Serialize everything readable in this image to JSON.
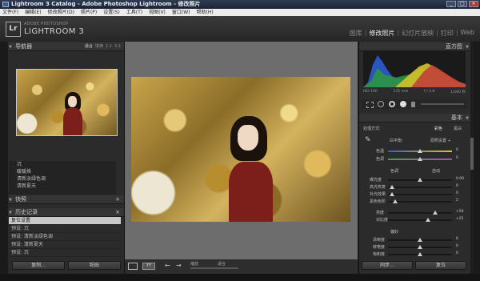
{
  "window": {
    "title": "Lightroom 3 Catalog - Adobe Photoshop Lightroom - 修改照片",
    "controls": [
      "_",
      "□",
      "×"
    ]
  },
  "menu": [
    "文件(F)",
    "编辑(E)",
    "修改照片(D)",
    "照片(P)",
    "设置(S)",
    "工具(T)",
    "视图(V)",
    "窗口(W)",
    "帮助(H)"
  ],
  "header": {
    "logo": "Lr",
    "brand_top": "ADOBE PHOTOSHOP",
    "brand": "LIGHTROOM 3",
    "modules": [
      "图库",
      "修改照片",
      "幻灯片放映",
      "打印",
      "Web"
    ],
    "separator": "|"
  },
  "left": {
    "navigator": {
      "title": "导航器",
      "options": [
        "适合",
        "填满",
        "1:1",
        "3:1"
      ]
    },
    "presets": [
      "沉",
      "暖暖焕",
      "清新淡绿色调",
      "清新夏天"
    ],
    "snapshots": {
      "title": "快照",
      "add": "+"
    },
    "history": {
      "title": "历史记录",
      "close": "×",
      "items": [
        "复位设置",
        "预设: 沉",
        "预设: 清新淡绿色调",
        "预设: 清新夏天",
        "预设: 沉"
      ]
    },
    "buttons": {
      "copy": "复制...",
      "paste": "粘贴"
    }
  },
  "toolbar": {
    "soft_proof": "校样",
    "zoom": "缩放",
    "zoom_value": "适合"
  },
  "right": {
    "histogram": {
      "title": "直方图",
      "iso": "ISO 100",
      "focal": "135 mm",
      "aperture": "f / 2.8",
      "shutter": "1/160 秒"
    },
    "basic": {
      "title": "基本",
      "treatment_label": "处理方式:",
      "color": "彩色",
      "bw": "黑白",
      "wb_label": "白平衡:",
      "wb_value": "原照设置 ÷",
      "temp": "色温",
      "tint": "色调",
      "tone": "色调",
      "auto": "自动",
      "exposure": "曝光度",
      "exposure_val": "0.00",
      "recovery": "高光恢复",
      "recovery_val": "0",
      "fill": "补光效果",
      "fill_val": "0",
      "blacks": "黑色色阶",
      "blacks_val": "5",
      "brightness": "亮度",
      "brightness_val": "+50",
      "contrast": "对比度",
      "contrast_val": "+25",
      "presence": "偏好",
      "clarity": "清晰度",
      "clarity_val": "0",
      "vibrance": "鲜艳度",
      "vibrance_val": "0",
      "saturation": "饱和度",
      "saturation_val": "0",
      "temp_val": "0",
      "tint_val": "0"
    },
    "buttons": {
      "sync": "同步...",
      "reset": "复位"
    }
  }
}
